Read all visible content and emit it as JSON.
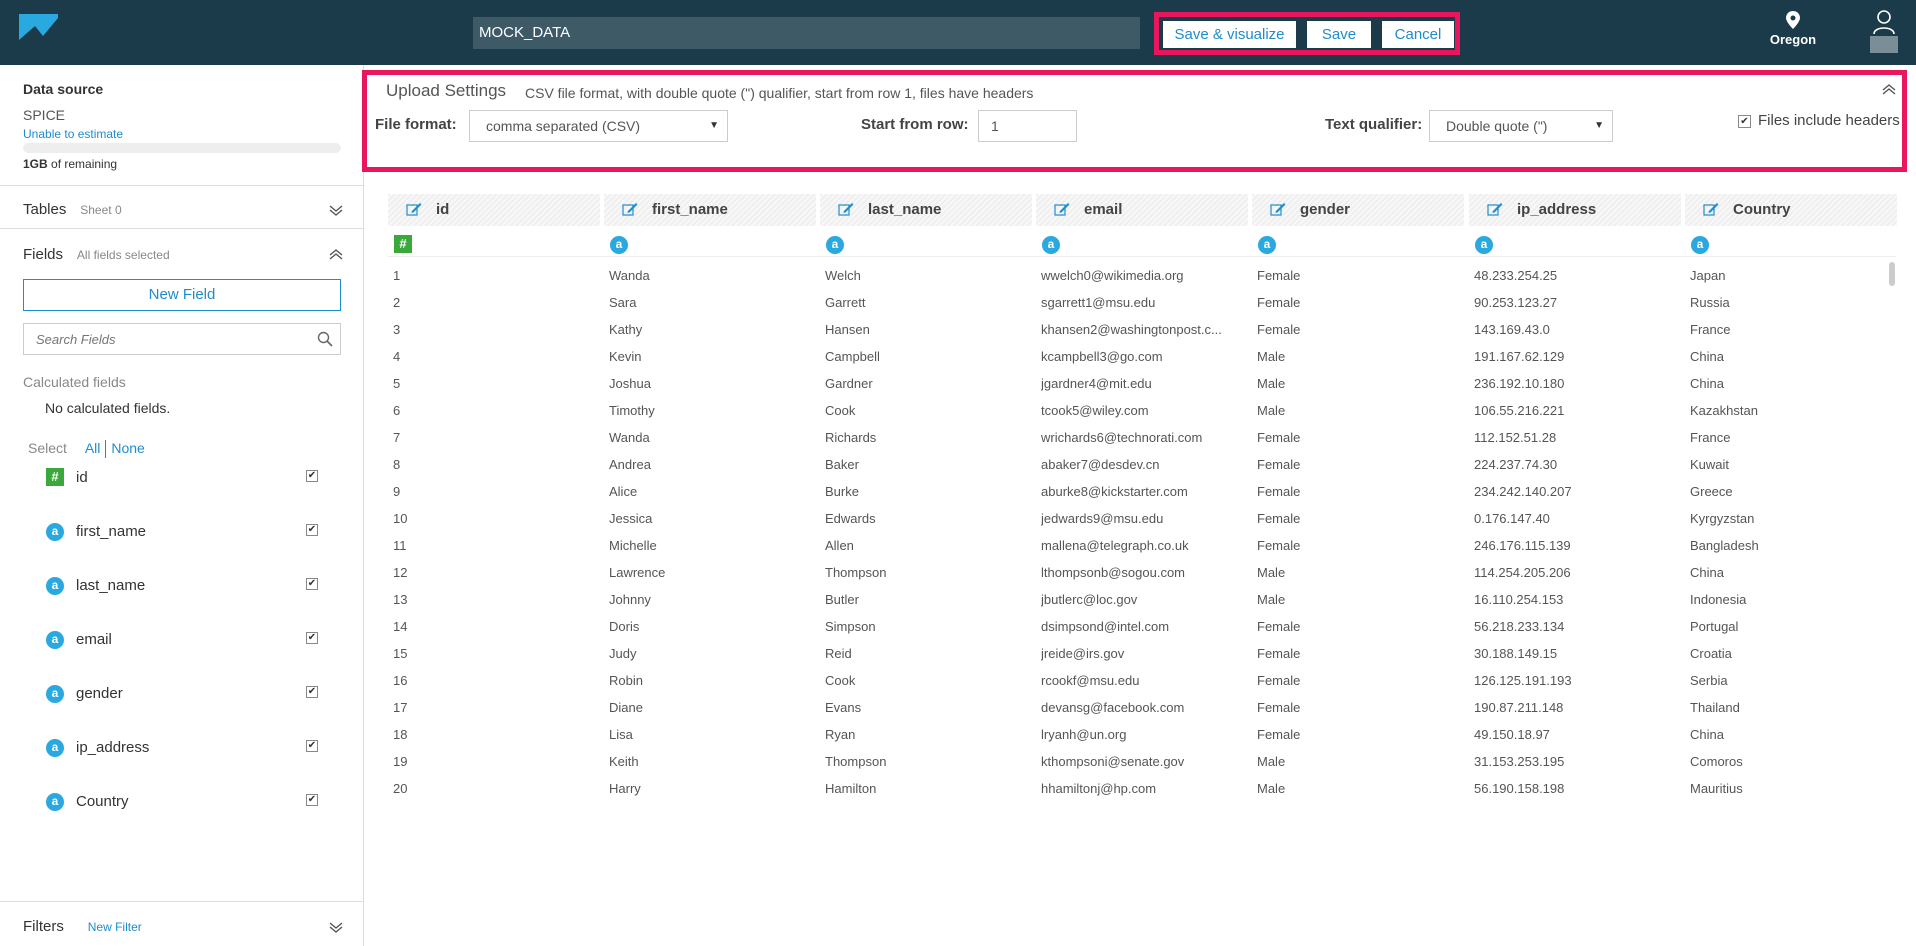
{
  "header": {
    "dataset_name": "MOCK_DATA",
    "save_visualize": "Save & visualize",
    "save": "Save",
    "cancel": "Cancel",
    "region": "Oregon"
  },
  "sidebar": {
    "data_source_title": "Data source",
    "data_source_type": "SPICE",
    "estimate_link": "Unable to estimate",
    "remaining_amount": "1GB",
    "remaining_text": " of remaining",
    "tables_title": "Tables",
    "tables_sub": "Sheet 0",
    "fields_title": "Fields",
    "fields_sub": "All fields selected",
    "new_field": "New Field",
    "search_placeholder": "Search Fields",
    "calc_title": "Calculated fields",
    "calc_empty": "No calculated fields.",
    "select_label": "Select",
    "select_all": "All",
    "select_none": "None",
    "fields": [
      {
        "name": "id",
        "type": "#"
      },
      {
        "name": "first_name",
        "type": "a"
      },
      {
        "name": "last_name",
        "type": "a"
      },
      {
        "name": "email",
        "type": "a"
      },
      {
        "name": "gender",
        "type": "a"
      },
      {
        "name": "ip_address",
        "type": "a"
      },
      {
        "name": "Country",
        "type": "a"
      }
    ],
    "filters_title": "Filters",
    "new_filter": "New Filter"
  },
  "upload": {
    "title": "Upload Settings",
    "description": "CSV file format, with double quote (\") qualifier, start from row 1, files have headers",
    "file_format_label": "File format:",
    "file_format_value": "comma separated (CSV)",
    "start_row_label": "Start from row:",
    "start_row_value": "1",
    "text_qualifier_label": "Text qualifier:",
    "text_qualifier_value": "Double quote (\")",
    "headers_label": "Files include headers"
  },
  "grid": {
    "columns": [
      "id",
      "first_name",
      "last_name",
      "email",
      "gender",
      "ip_address",
      "Country"
    ],
    "types": [
      "#",
      "a",
      "a",
      "a",
      "a",
      "a",
      "a"
    ],
    "rows": [
      [
        "1",
        "Wanda",
        "Welch",
        "wwelch0@wikimedia.org",
        "Female",
        "48.233.254.25",
        "Japan"
      ],
      [
        "2",
        "Sara",
        "Garrett",
        "sgarrett1@msu.edu",
        "Female",
        "90.253.123.27",
        "Russia"
      ],
      [
        "3",
        "Kathy",
        "Hansen",
        "khansen2@washingtonpost.c...",
        "Female",
        "143.169.43.0",
        "France"
      ],
      [
        "4",
        "Kevin",
        "Campbell",
        "kcampbell3@go.com",
        "Male",
        "191.167.62.129",
        "China"
      ],
      [
        "5",
        "Joshua",
        "Gardner",
        "jgardner4@mit.edu",
        "Male",
        "236.192.10.180",
        "China"
      ],
      [
        "6",
        "Timothy",
        "Cook",
        "tcook5@wiley.com",
        "Male",
        "106.55.216.221",
        "Kazakhstan"
      ],
      [
        "7",
        "Wanda",
        "Richards",
        "wrichards6@technorati.com",
        "Female",
        "112.152.51.28",
        "France"
      ],
      [
        "8",
        "Andrea",
        "Baker",
        "abaker7@desdev.cn",
        "Female",
        "224.237.74.30",
        "Kuwait"
      ],
      [
        "9",
        "Alice",
        "Burke",
        "aburke8@kickstarter.com",
        "Female",
        "234.242.140.207",
        "Greece"
      ],
      [
        "10",
        "Jessica",
        "Edwards",
        "jedwards9@msu.edu",
        "Female",
        "0.176.147.40",
        "Kyrgyzstan"
      ],
      [
        "11",
        "Michelle",
        "Allen",
        "mallena@telegraph.co.uk",
        "Female",
        "246.176.115.139",
        "Bangladesh"
      ],
      [
        "12",
        "Lawrence",
        "Thompson",
        "lthompsonb@sogou.com",
        "Male",
        "114.254.205.206",
        "China"
      ],
      [
        "13",
        "Johnny",
        "Butler",
        "jbutlerc@loc.gov",
        "Male",
        "16.110.254.153",
        "Indonesia"
      ],
      [
        "14",
        "Doris",
        "Simpson",
        "dsimpsond@intel.com",
        "Female",
        "56.218.233.134",
        "Portugal"
      ],
      [
        "15",
        "Judy",
        "Reid",
        "jreide@irs.gov",
        "Female",
        "30.188.149.15",
        "Croatia"
      ],
      [
        "16",
        "Robin",
        "Cook",
        "rcookf@msu.edu",
        "Female",
        "126.125.191.193",
        "Serbia"
      ],
      [
        "17",
        "Diane",
        "Evans",
        "devansg@facebook.com",
        "Female",
        "190.87.211.148",
        "Thailand"
      ],
      [
        "18",
        "Lisa",
        "Ryan",
        "lryanh@un.org",
        "Female",
        "49.150.18.97",
        "China"
      ],
      [
        "19",
        "Keith",
        "Thompson",
        "kthompsoni@senate.gov",
        "Male",
        "31.153.253.195",
        "Comoros"
      ],
      [
        "20",
        "Harry",
        "Hamilton",
        "hhamiltonj@hp.com",
        "Male",
        "56.190.158.198",
        "Mauritius"
      ]
    ]
  },
  "colors": {
    "topbar": "#1c3b4a",
    "accent_blue": "#1f8ccc",
    "highlight": "#e8175d",
    "number_icon": "#3aa83a",
    "string_icon": "#2aa8e0"
  }
}
